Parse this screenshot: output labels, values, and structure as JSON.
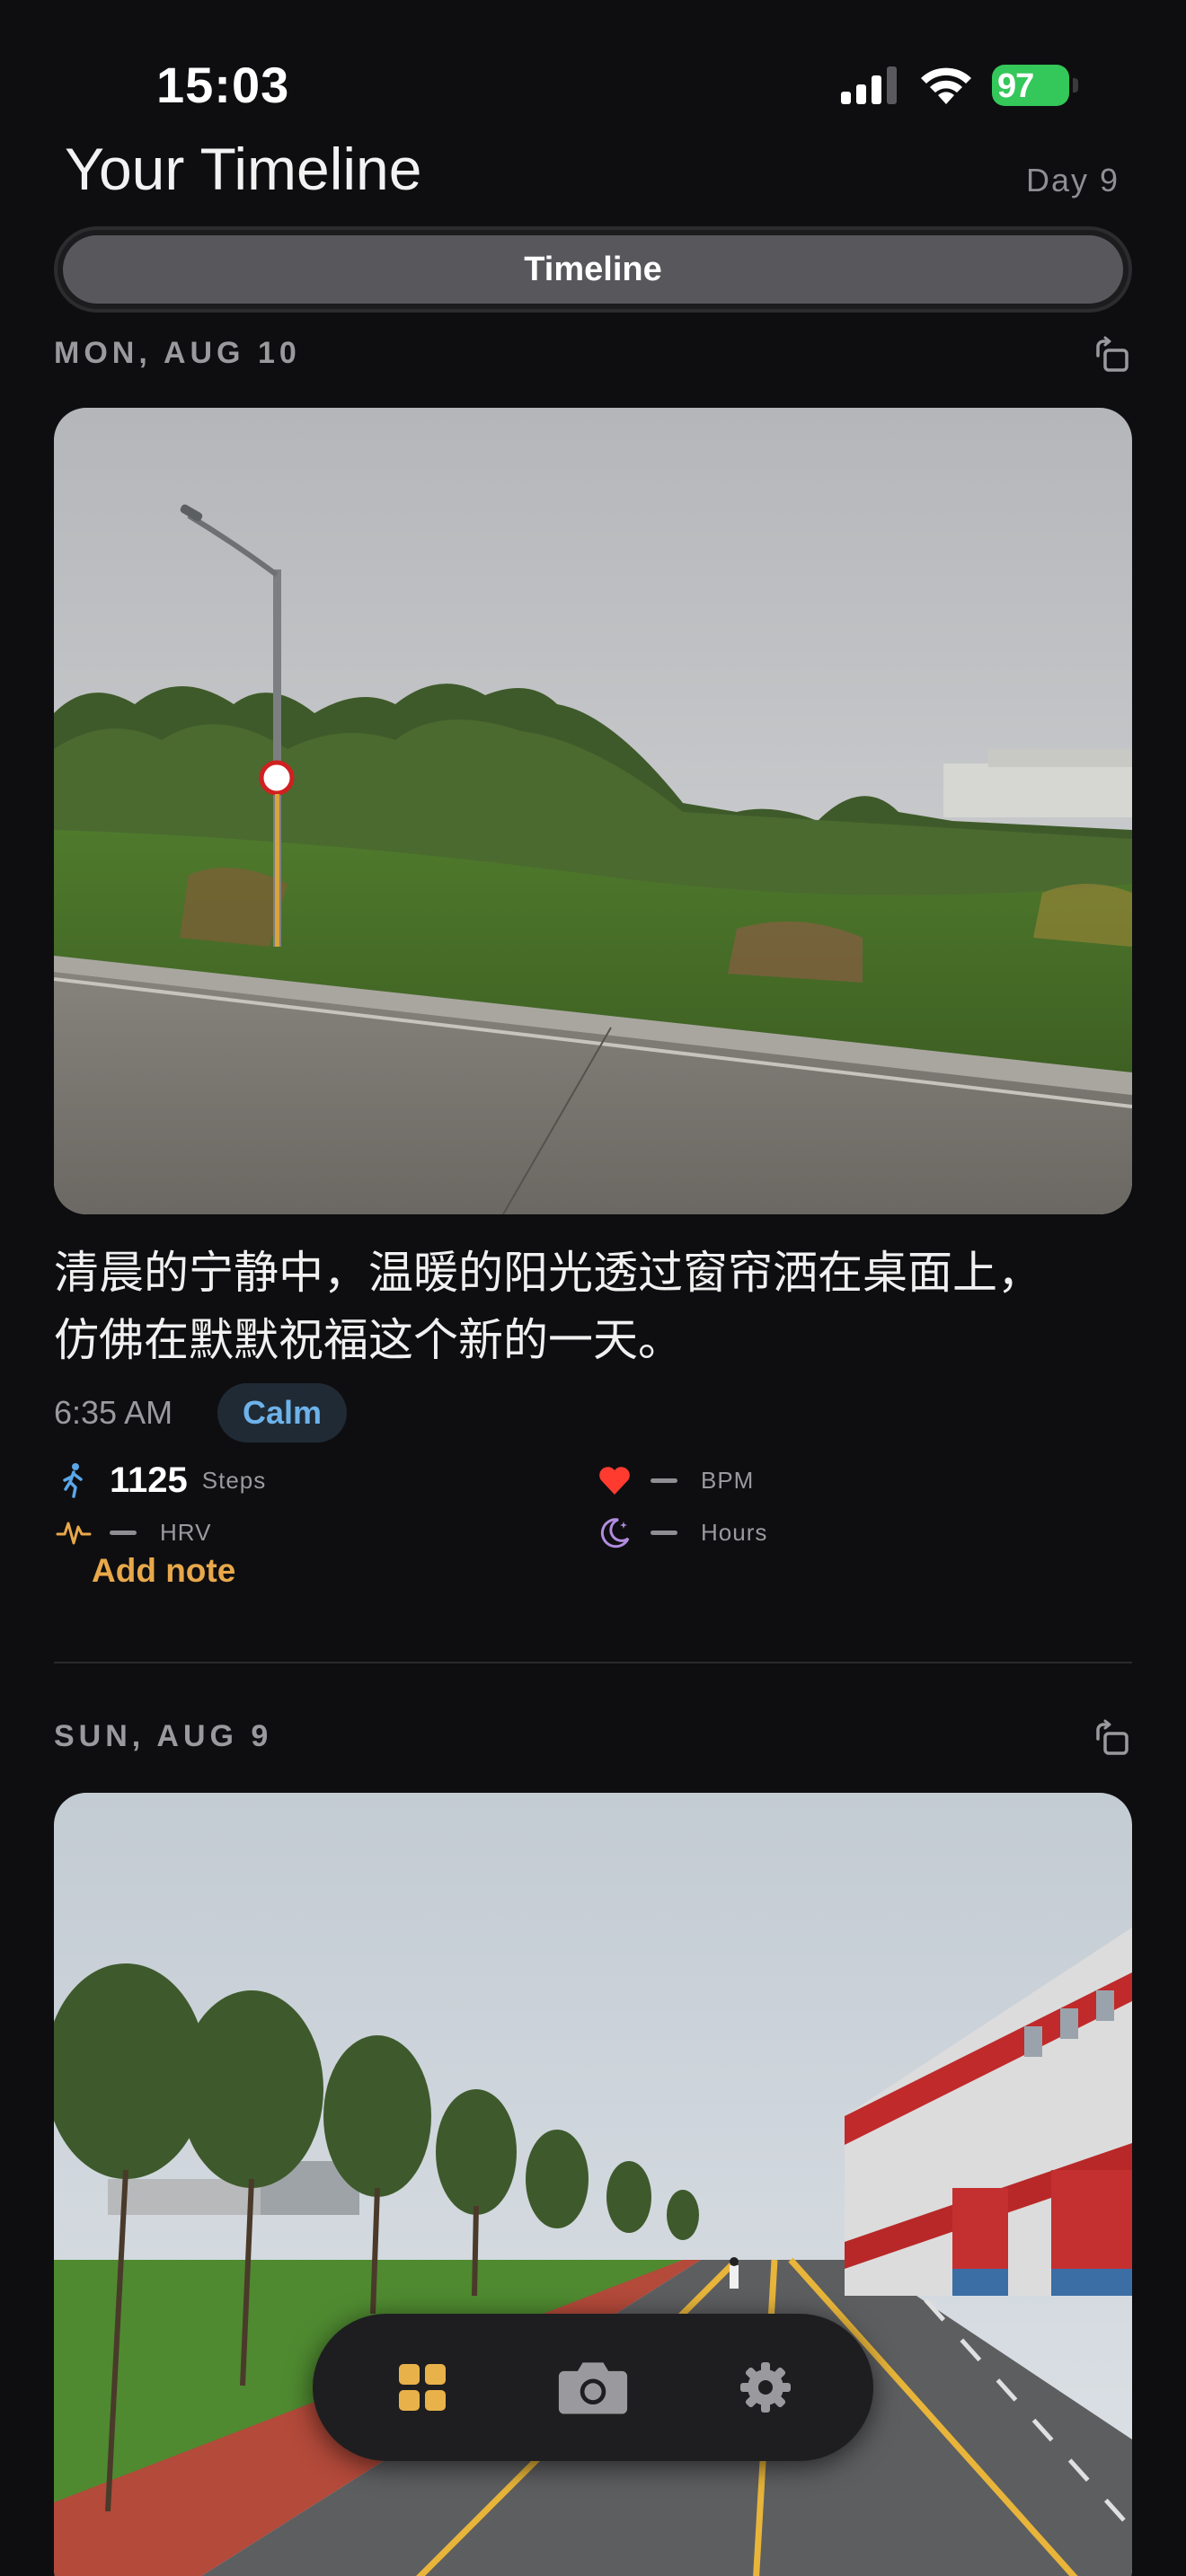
{
  "status_bar": {
    "time": "15:03",
    "battery": "97"
  },
  "header": {
    "title": "Your Timeline",
    "day_label": "Day 9"
  },
  "segmented": {
    "active_label": "Timeline"
  },
  "entries": [
    {
      "date": "MON, AUG 10",
      "caption_line1": "清晨的宁静中，温暖的阳光透过窗帘洒在桌面上，",
      "caption_line2": "仿佛在默默祝福这个新的一天。",
      "time": "6:35 AM",
      "mood": "Calm",
      "steps_value": "1125",
      "steps_unit": "Steps",
      "bpm_unit": "BPM",
      "hrv_unit": "HRV",
      "sleep_unit": "Hours",
      "add_note_label": "Add note"
    },
    {
      "date": "SUN, AUG 9"
    }
  ],
  "tab_bar": {
    "icons": [
      "grid-icon",
      "camera-icon",
      "gear-icon"
    ],
    "accent_color": "#e8b14a"
  },
  "colors": {
    "background": "#0e0e10",
    "accent": "#e8a84a",
    "mood_badge_text": "#6eb2ea",
    "heart": "#ff3b30",
    "battery": "#34c759"
  }
}
